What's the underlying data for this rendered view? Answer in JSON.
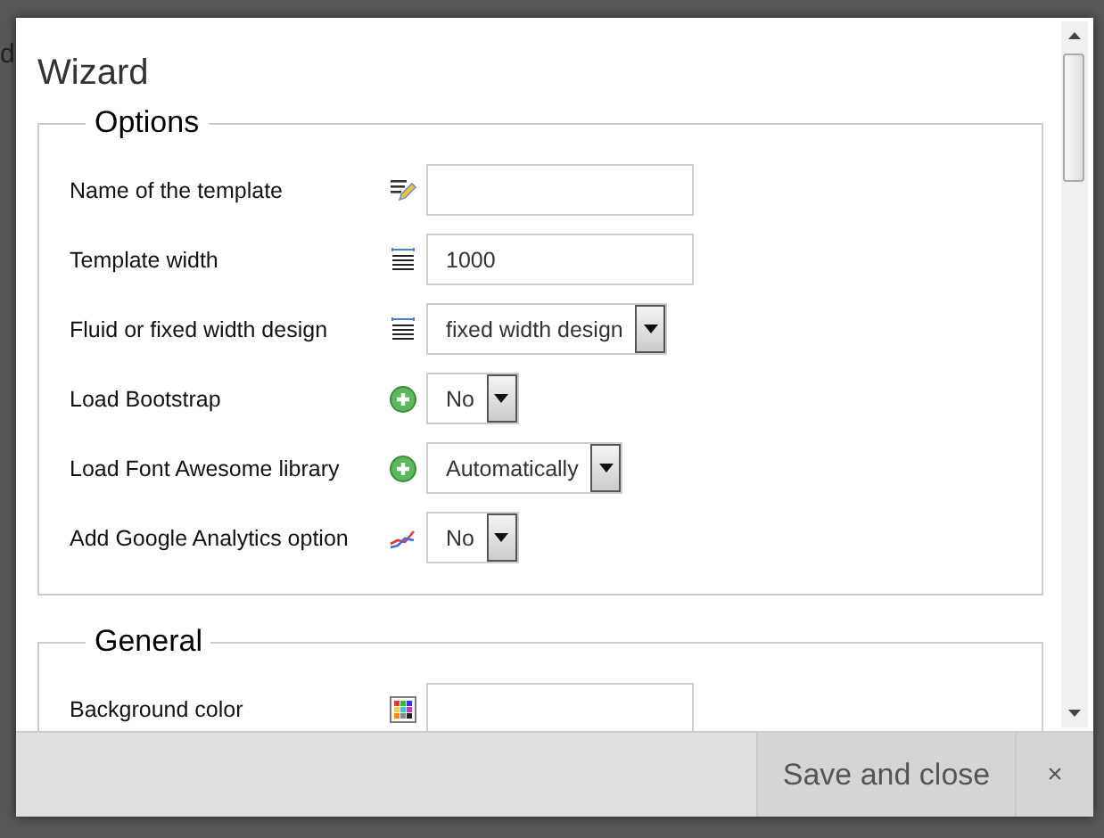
{
  "backdrop": {
    "top_text": "d"
  },
  "dialog": {
    "title": "Wizard",
    "sections": [
      {
        "legend": "Options",
        "rows": [
          {
            "label": "Name of the template",
            "kind": "input"
          },
          {
            "label": "Template width",
            "kind": "input",
            "value": "1000"
          },
          {
            "label": "Fluid or fixed width design",
            "kind": "select",
            "value": "fixed width design"
          },
          {
            "label": "Load Bootstrap",
            "kind": "select",
            "value": "No"
          },
          {
            "label": "Load Font Awesome library",
            "kind": "select",
            "value": "Automatically"
          },
          {
            "label": "Add Google Analytics option",
            "kind": "select",
            "value": "No"
          }
        ]
      },
      {
        "legend": "General",
        "rows": [
          {
            "label": "Background color",
            "kind": "input"
          }
        ]
      }
    ],
    "footer": {
      "save": "Save and close",
      "close": "×"
    }
  }
}
